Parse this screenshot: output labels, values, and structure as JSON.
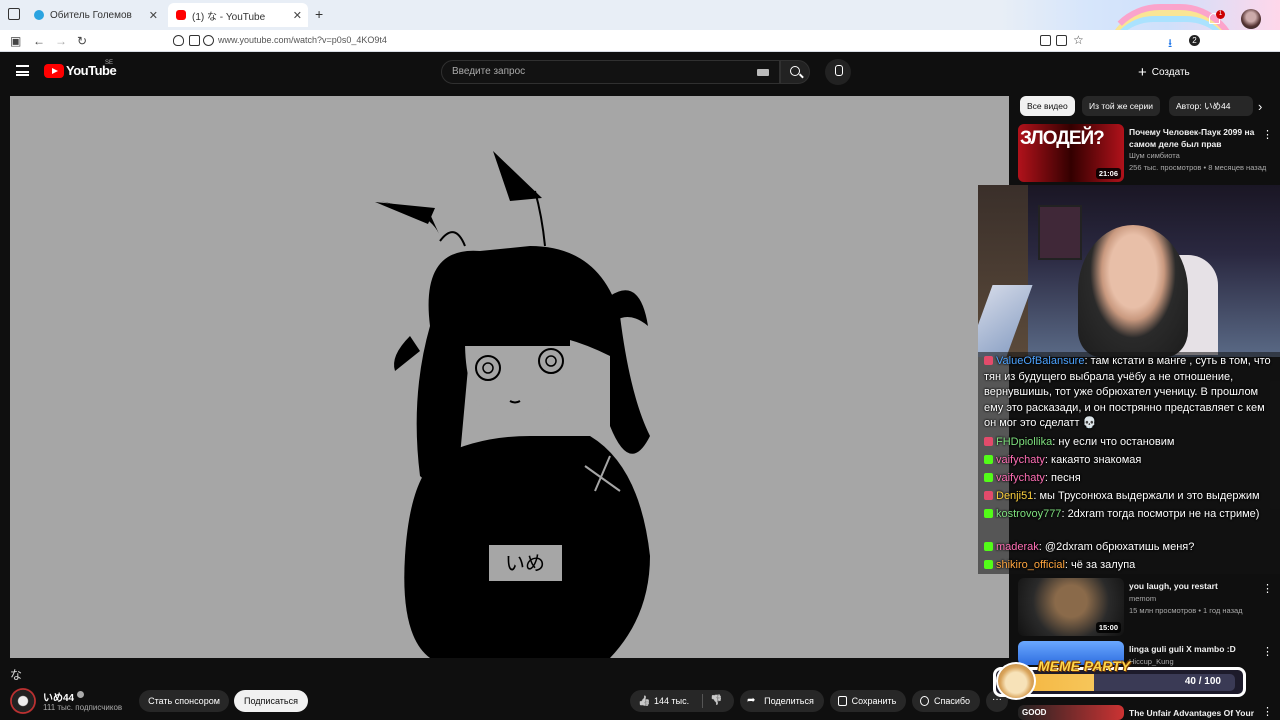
{
  "browser": {
    "tabs": [
      {
        "title": "Обитель Големов",
        "close": "✕"
      },
      {
        "title": "(1) な - YouTube",
        "close": "✕"
      }
    ],
    "new_tab": "+",
    "url": "www.youtube.com/watch?v=p0s0_4KO9t4",
    "profile_badge": "2"
  },
  "header": {
    "logo_text": "YouTube",
    "region": "SE",
    "search_placeholder": "Введите запрос",
    "create_label": "Создать",
    "notifications_count": "1"
  },
  "video": {
    "channel_name": "いめ44",
    "subscribers": "111 тыс. подписчиков",
    "sponsor_label": "Стать спонсором",
    "subscribe_label": "Подписаться",
    "likes": "144 тыс.",
    "share_label": "Поделиться",
    "save_label": "Сохранить",
    "thanks_label": "Спасибо",
    "more_label": "···",
    "corner_glyph": "な",
    "name_tag_text": "いめ"
  },
  "sidebar": {
    "chips": [
      "Все видео",
      "Из той же серии",
      "Автор: いめ44"
    ],
    "chip_next": "›",
    "recommendations": [
      {
        "title": "Почему Человек-Паук 2099 на самом деле был прав",
        "channel": "Шум симбиота",
        "meta": "256 тыс. просмотров • 8 месяцев назад",
        "duration": "21:06",
        "thumb_text": "ЗЛОДЕЙ?"
      },
      {
        "title": "you laugh, you restart",
        "channel": "memom",
        "meta": "15 млн просмотров • 1 год назад",
        "duration": "15:00"
      },
      {
        "title": "linga guli guli X mambo :D",
        "channel": "Hiccup_Kung",
        "meta": "",
        "duration": ""
      },
      {
        "title": "The Unfair Advantages Of Your",
        "channel": "",
        "meta": "",
        "duration": "",
        "thumb_text": "GOOD"
      }
    ],
    "more": "⋮"
  },
  "stream_chat": [
    {
      "platform": "vk",
      "user": "ValueOfBalansure",
      "user_color": "#4da3ff",
      "text": "там кстати в манге , суть в том, что тян из будущего выбрала учёбу а не отношение, вернувшишь, тот уже обрюхател ученицу. В прошлом ему это расказади, и он пострянно представляет с кем он мог это сделатт 💀"
    },
    {
      "platform": "vk",
      "user": "FHDpiollika",
      "user_color": "#7ee07e",
      "text": "ну если что остановим"
    },
    {
      "platform": "kick",
      "user": "vaifychaty",
      "user_color": "#ff6fb5",
      "text": "какаято знакомая"
    },
    {
      "platform": "kick",
      "user": "vaifychaty",
      "user_color": "#ff6fb5",
      "text": "песня"
    },
    {
      "platform": "vk",
      "user": "Denji51",
      "user_color": "#ffd23f",
      "text": "мы Трусонюха выдержали и это выдержим"
    },
    {
      "platform": "kick",
      "user": "kostrovoy777",
      "user_color": "#7ee07e",
      "text": "2dxram тогда посмотри не на стриме)"
    },
    {
      "platform": "kick",
      "user": "maderak",
      "user_color": "#ff6fb5",
      "text": "@2dxram обрюхатишь меня?"
    },
    {
      "platform": "kick",
      "user": "shikiro_official",
      "user_color": "#ffa53f",
      "text": "чё за залупа"
    }
  ],
  "meme_party": {
    "title": "MEME PARTY",
    "count": "40 / 100",
    "progress": 0.4
  },
  "colors": {
    "background": "#0f0f0f",
    "accent_red": "#ff0000",
    "player_bg": "#a6a6a6"
  }
}
